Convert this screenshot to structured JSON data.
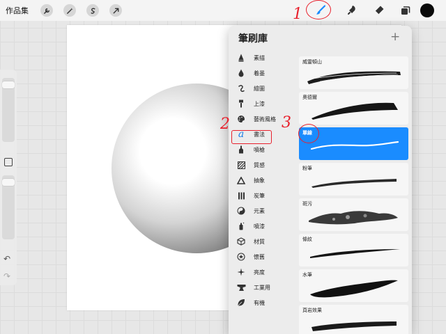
{
  "toolbar": {
    "gallery_label": "作品集",
    "left_tools": [
      "wrench-icon",
      "magic-wand-icon",
      "selection-icon",
      "transform-arrow-icon"
    ],
    "right_tools": [
      "brush-icon",
      "smudge-icon",
      "eraser-icon",
      "layers-icon"
    ],
    "active_tool": "brush-icon",
    "color_swatch": "#0a0a0a"
  },
  "sidebar": {
    "size_slider_level": 0.05,
    "opacity_slider_level": 0.05,
    "modify_button": "square-icon",
    "undo_label": "↶",
    "redo_label": "↷"
  },
  "brush_library": {
    "title": "筆刷庫",
    "add_label": "+",
    "categories": [
      {
        "label": "素描",
        "icon": "pencil-nib-icon"
      },
      {
        "label": "着墨",
        "icon": "ink-drop-icon"
      },
      {
        "label": "繪圖",
        "icon": "swirl-icon"
      },
      {
        "label": "上漆",
        "icon": "paint-roller-icon"
      },
      {
        "label": "藝術風格",
        "icon": "palette-icon"
      },
      {
        "label": "書法",
        "icon": "calligraphy-a-icon",
        "selected": true
      },
      {
        "label": "噴槍",
        "icon": "airbrush-icon"
      },
      {
        "label": "質感",
        "icon": "texture-icon"
      },
      {
        "label": "抽象",
        "icon": "triangle-icon"
      },
      {
        "label": "炭筆",
        "icon": "charcoal-bars-icon"
      },
      {
        "label": "元素",
        "icon": "yin-yang-icon"
      },
      {
        "label": "噴漆",
        "icon": "spray-can-icon"
      },
      {
        "label": "材質",
        "icon": "cube-icon"
      },
      {
        "label": "懷舊",
        "icon": "star-badge-icon"
      },
      {
        "label": "亮度",
        "icon": "sparkle-icon"
      },
      {
        "label": "工業用",
        "icon": "anvil-icon"
      },
      {
        "label": "有機",
        "icon": "leaf-icon"
      }
    ],
    "brushes": [
      {
        "name": "威靈頓山",
        "stroke": "dry-brush"
      },
      {
        "name": "奧德爾",
        "stroke": "wedge"
      },
      {
        "name": "單線",
        "stroke": "monoline",
        "selected": true
      },
      {
        "name": "粉筆",
        "stroke": "chalk"
      },
      {
        "name": "斑污",
        "stroke": "blotch"
      },
      {
        "name": "條紋",
        "stroke": "streak"
      },
      {
        "name": "水筆",
        "stroke": "water-pen"
      },
      {
        "name": "頁岩效果",
        "stroke": "shale"
      }
    ],
    "accent_color": "#1a8cff"
  },
  "annotations": {
    "color": "#e8202c",
    "step1": "1",
    "step2": "2",
    "step3": "3"
  }
}
